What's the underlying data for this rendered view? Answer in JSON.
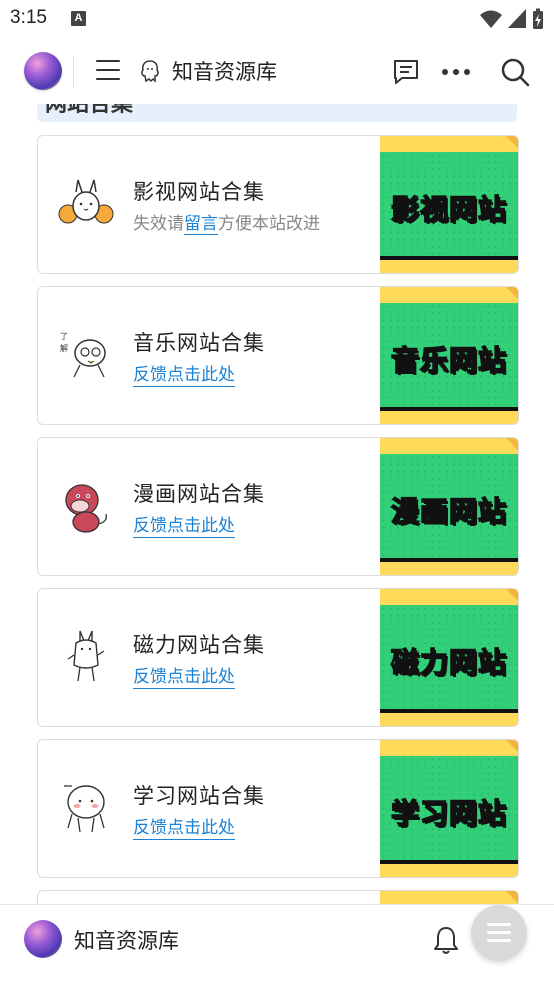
{
  "status_bar": {
    "time": "3:15",
    "notification_badge": "A"
  },
  "app_bar": {
    "site_title": "知音资源库"
  },
  "section": {
    "heading": "网站合集"
  },
  "cards": [
    {
      "title": "影视网站合集",
      "sub_prefix": "失效请",
      "sub_link": "留言",
      "sub_suffix": "方便本站改进",
      "banner": "影视网站",
      "icon": "bunny-pompom-sticker-icon"
    },
    {
      "title": "音乐网站合集",
      "link": "反馈点击此处",
      "banner": "音乐网站",
      "icon": "cat-understand-sticker-icon"
    },
    {
      "title": "漫画网站合集",
      "link": "反馈点击此处",
      "banner": "漫画网站",
      "icon": "red-dinosaur-sticker-icon"
    },
    {
      "title": "磁力网站合集",
      "link": "反馈点击此处",
      "banner": "磁力网站",
      "icon": "bunny-sticker-icon"
    },
    {
      "title": "学习网站合集",
      "link": "反馈点击此处",
      "banner": "学习网站",
      "icon": "blushing-ghost-sticker-icon"
    }
  ],
  "bottom_bar": {
    "site_title": "知音资源库"
  },
  "colors": {
    "link": "#1a82d6",
    "banner_green": "#33d07a",
    "banner_yellow": "#ffd95a"
  }
}
